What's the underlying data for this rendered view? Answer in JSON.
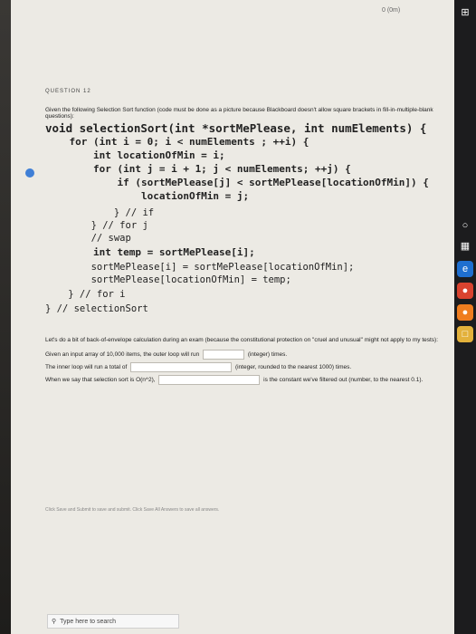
{
  "window": {
    "clock": "0 (0m)"
  },
  "question": {
    "number_label": "QUESTION 12",
    "instructions": "Given the following Selection Sort function (code must be done as a picture because Blackboard doesn't allow square brackets in fill-in-multiple-blank questions):"
  },
  "code": {
    "line1": "void selectionSort(int *sortMePlease, int numElements) {",
    "line2": "    for (int i = 0; i < numElements ; ++i) {",
    "line3": "        int locationOfMin = i;",
    "line4": "        for (int j = i + 1; j < numElements; ++j) {",
    "line5": "            if (sortMePlease[j] < sortMePlease[locationOfMin]) {",
    "line6": "                locationOfMin = j;",
    "line7": "            } // if",
    "line8": "        } // for j",
    "line9": "        // swap",
    "line10": "        int temp = sortMePlease[i];",
    "line11": "        sortMePlease[i] = sortMePlease[locationOfMin];",
    "line12": "        sortMePlease[locationOfMin] = temp;",
    "line13": "    } // for i",
    "line14": "} // selectionSort"
  },
  "prompt": {
    "p1": "Let's do a bit of back-of-envelope calculation during an exam (because the constitutional protection on \"cruel and unusual\" might not apply to my tests):",
    "p2a": "Given an input array of 10,000 items, the outer loop will run",
    "p2b": "(integer) times.",
    "p3a": "The inner loop will run a total of",
    "p3b": "(integer, rounded to the nearest 1000) times.",
    "p4a": "When we say that selection sort is O(n^2),",
    "p4b": "is the constant we've filtered out (number, to the nearest 0.1).",
    "footer": "Click Save and Submit to save and submit. Click Save All Answers to save all answers."
  },
  "taskbar": {
    "search_placeholder": "Type here to search"
  }
}
